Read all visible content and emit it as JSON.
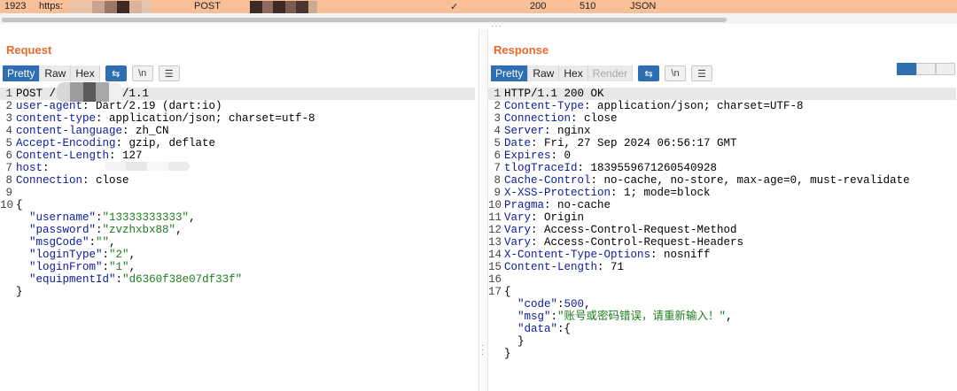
{
  "history": {
    "index": "1923",
    "scheme": "https:",
    "method": "POST",
    "checkmark": "✓",
    "status": "200",
    "length": "510",
    "mime": "JSON"
  },
  "request": {
    "title": "Request",
    "tabs": [
      "Pretty",
      "Raw",
      "Hex"
    ],
    "active_tab": "Pretty",
    "lines": [
      {
        "n": "1",
        "parts": [
          {
            "t": "POST ",
            "c": ""
          },
          {
            "t": "/",
            "c": "redacted"
          },
          {
            "t": "login HTTP/1.1",
            "c": ""
          }
        ],
        "hl": true
      },
      {
        "n": "2",
        "parts": [
          {
            "t": "user-agent",
            "c": "hname"
          },
          {
            "t": ": Dart/2.19 (dart:io)",
            "c": ""
          }
        ]
      },
      {
        "n": "3",
        "parts": [
          {
            "t": "content-type",
            "c": "hname"
          },
          {
            "t": ": application/json; charset=utf-8",
            "c": ""
          }
        ]
      },
      {
        "n": "4",
        "parts": [
          {
            "t": "content-language",
            "c": "hname"
          },
          {
            "t": ": zh_CN",
            "c": ""
          }
        ]
      },
      {
        "n": "5",
        "parts": [
          {
            "t": "Accept-Encoding",
            "c": "hname"
          },
          {
            "t": ": gzip, deflate",
            "c": ""
          }
        ]
      },
      {
        "n": "6",
        "parts": [
          {
            "t": "Content-Length",
            "c": "hname"
          },
          {
            "t": ": 127",
            "c": ""
          }
        ]
      },
      {
        "n": "7",
        "parts": [
          {
            "t": "host",
            "c": "hname"
          },
          {
            "t": ":",
            "c": ""
          }
        ]
      },
      {
        "n": "8",
        "parts": [
          {
            "t": "Connection",
            "c": "hname"
          },
          {
            "t": ": close",
            "c": ""
          }
        ]
      },
      {
        "n": "9",
        "parts": []
      },
      {
        "n": "10",
        "parts": [
          {
            "t": "{",
            "c": ""
          }
        ]
      },
      {
        "n": "",
        "parts": [
          {
            "t": "  ",
            "c": ""
          },
          {
            "t": "\"username\"",
            "c": "jkey"
          },
          {
            "t": ":",
            "c": ""
          },
          {
            "t": "\"13333333333\"",
            "c": "jstr"
          },
          {
            "t": ",",
            "c": ""
          }
        ]
      },
      {
        "n": "",
        "parts": [
          {
            "t": "  ",
            "c": ""
          },
          {
            "t": "\"password\"",
            "c": "jkey"
          },
          {
            "t": ":",
            "c": ""
          },
          {
            "t": "\"zvzhxbx88\"",
            "c": "jstr"
          },
          {
            "t": ",",
            "c": ""
          }
        ]
      },
      {
        "n": "",
        "parts": [
          {
            "t": "  ",
            "c": ""
          },
          {
            "t": "\"msgCode\"",
            "c": "jkey"
          },
          {
            "t": ":",
            "c": ""
          },
          {
            "t": "\"\"",
            "c": "jstr"
          },
          {
            "t": ",",
            "c": ""
          }
        ]
      },
      {
        "n": "",
        "parts": [
          {
            "t": "  ",
            "c": ""
          },
          {
            "t": "\"loginType\"",
            "c": "jkey"
          },
          {
            "t": ":",
            "c": ""
          },
          {
            "t": "\"2\"",
            "c": "jstr"
          },
          {
            "t": ",",
            "c": ""
          }
        ]
      },
      {
        "n": "",
        "parts": [
          {
            "t": "  ",
            "c": ""
          },
          {
            "t": "\"loginFrom\"",
            "c": "jkey"
          },
          {
            "t": ":",
            "c": ""
          },
          {
            "t": "\"1\"",
            "c": "jstr"
          },
          {
            "t": ",",
            "c": ""
          }
        ]
      },
      {
        "n": "",
        "parts": [
          {
            "t": "  ",
            "c": ""
          },
          {
            "t": "\"equipmentId\"",
            "c": "jkey"
          },
          {
            "t": ":",
            "c": ""
          },
          {
            "t": "\"d6360f38e07df33f\"",
            "c": "jstr"
          }
        ]
      },
      {
        "n": "",
        "parts": [
          {
            "t": "}",
            "c": ""
          }
        ]
      }
    ]
  },
  "response": {
    "title": "Response",
    "tabs": [
      "Pretty",
      "Raw",
      "Hex",
      "Render"
    ],
    "active_tab": "Pretty",
    "lines": [
      {
        "n": "1",
        "parts": [
          {
            "t": "HTTP/1.1 200 OK",
            "c": ""
          }
        ],
        "hl": true
      },
      {
        "n": "2",
        "parts": [
          {
            "t": "Content-Type",
            "c": "hname"
          },
          {
            "t": ": application/json; charset=UTF-8",
            "c": ""
          }
        ]
      },
      {
        "n": "3",
        "parts": [
          {
            "t": "Connection",
            "c": "hname"
          },
          {
            "t": ": close",
            "c": ""
          }
        ]
      },
      {
        "n": "4",
        "parts": [
          {
            "t": "Server",
            "c": "hname"
          },
          {
            "t": ": nginx",
            "c": ""
          }
        ]
      },
      {
        "n": "5",
        "parts": [
          {
            "t": "Date",
            "c": "hname"
          },
          {
            "t": ": Fri, 27 Sep 2024 06:56:17 GMT",
            "c": ""
          }
        ]
      },
      {
        "n": "6",
        "parts": [
          {
            "t": "Expires",
            "c": "hname"
          },
          {
            "t": ": 0",
            "c": ""
          }
        ]
      },
      {
        "n": "7",
        "parts": [
          {
            "t": "tlogTraceId",
            "c": "hname"
          },
          {
            "t": ": 1839559671260540928",
            "c": ""
          }
        ]
      },
      {
        "n": "8",
        "parts": [
          {
            "t": "Cache-Control",
            "c": "hname"
          },
          {
            "t": ": no-cache, no-store, max-age=0, must-revalidate",
            "c": ""
          }
        ]
      },
      {
        "n": "9",
        "parts": [
          {
            "t": "X-XSS-Protection",
            "c": "hname"
          },
          {
            "t": ": 1; mode=block",
            "c": ""
          }
        ]
      },
      {
        "n": "10",
        "parts": [
          {
            "t": "Pragma",
            "c": "hname"
          },
          {
            "t": ": no-cache",
            "c": ""
          }
        ]
      },
      {
        "n": "11",
        "parts": [
          {
            "t": "Vary",
            "c": "hname"
          },
          {
            "t": ": Origin",
            "c": ""
          }
        ]
      },
      {
        "n": "12",
        "parts": [
          {
            "t": "Vary",
            "c": "hname"
          },
          {
            "t": ": Access-Control-Request-Method",
            "c": ""
          }
        ]
      },
      {
        "n": "13",
        "parts": [
          {
            "t": "Vary",
            "c": "hname"
          },
          {
            "t": ": Access-Control-Request-Headers",
            "c": ""
          }
        ]
      },
      {
        "n": "14",
        "parts": [
          {
            "t": "X-Content-Type-Options",
            "c": "hname"
          },
          {
            "t": ": nosniff",
            "c": ""
          }
        ]
      },
      {
        "n": "15",
        "parts": [
          {
            "t": "Content-Length",
            "c": "hname"
          },
          {
            "t": ": 71",
            "c": ""
          }
        ]
      },
      {
        "n": "16",
        "parts": []
      },
      {
        "n": "17",
        "parts": [
          {
            "t": "{",
            "c": ""
          }
        ]
      },
      {
        "n": "",
        "parts": [
          {
            "t": "  ",
            "c": ""
          },
          {
            "t": "\"code\"",
            "c": "jkey"
          },
          {
            "t": ":",
            "c": ""
          },
          {
            "t": "500",
            "c": "jnum"
          },
          {
            "t": ",",
            "c": ""
          }
        ]
      },
      {
        "n": "",
        "parts": [
          {
            "t": "  ",
            "c": ""
          },
          {
            "t": "\"msg\"",
            "c": "jkey"
          },
          {
            "t": ":",
            "c": ""
          },
          {
            "t": "\"账号或密码错误，请重新输入！\"",
            "c": "jstr"
          },
          {
            "t": ",",
            "c": ""
          }
        ]
      },
      {
        "n": "",
        "parts": [
          {
            "t": "  ",
            "c": ""
          },
          {
            "t": "\"data\"",
            "c": "jkey"
          },
          {
            "t": ":{",
            "c": ""
          }
        ]
      },
      {
        "n": "",
        "parts": [
          {
            "t": "  }",
            "c": ""
          }
        ]
      },
      {
        "n": "",
        "parts": [
          {
            "t": "}",
            "c": ""
          }
        ]
      }
    ]
  },
  "toolbar_icons": {
    "wrap": "⇆",
    "newline": "\\n",
    "menu": "☰"
  },
  "colors": {
    "accent": "#e8682c",
    "active_tab": "#2d6fb2",
    "history_row": "#f9bf96"
  }
}
